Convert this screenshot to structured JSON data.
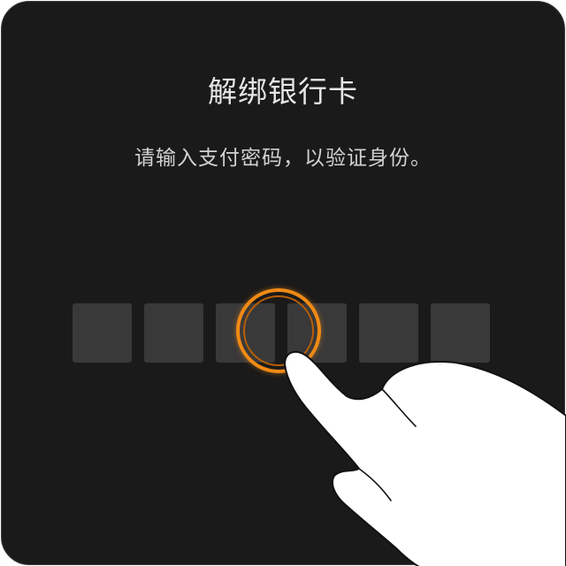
{
  "dialog": {
    "title": "解绑银行卡",
    "subtitle": "请输入支付密码，以验证身份。"
  },
  "pin": {
    "length": 6,
    "filled": 0
  },
  "overlay": {
    "ring_color": "#f08a15",
    "pointer_icon": "hand-pointer-icon"
  },
  "colors": {
    "background": "#1b1a1a",
    "pin_box": "#3a3939",
    "text": "#e6e6e6",
    "accent": "#f08a15"
  }
}
